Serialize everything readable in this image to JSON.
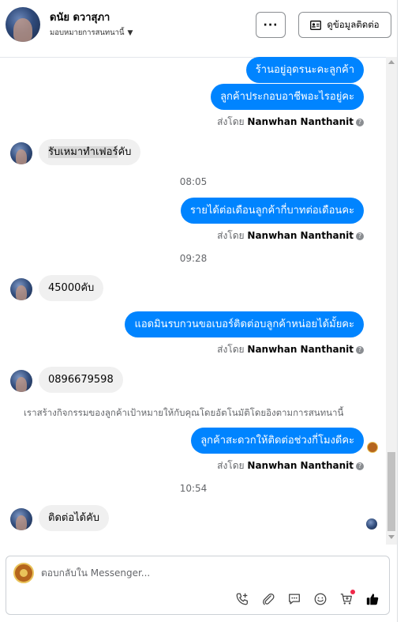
{
  "header": {
    "name": "ดนัย ดวาสุภา",
    "subtitle": "มอบหมายการสนทนานี้",
    "more_label": "···",
    "contact_label": "ดูข้อมูลติดต่อ"
  },
  "messages": {
    "out1": "ร้านอยู่อุดรนะคะลูกค้า",
    "out2": "ลูกค้าประกอบอาชีพอะไรอยู่คะ",
    "sent_prefix": "ส่งโดย",
    "sender": "Nanwhan Nanthanit",
    "in1": "รับเหมาทำเฟอร์คับ",
    "in1_highlight": "รับเหมาทำเฟอร์",
    "in1_rest": "คับ",
    "time1": "08:05",
    "out3": "รายได้ต่อเดือนลูกค้ากี่บาทต่อเดือนคะ",
    "time2": "09:28",
    "in2": "45000คับ",
    "out4": "แอดมินรบกวนขอเบอร์ติดต่อบลูกค้าหน่อยได้มั้ยคะ",
    "in3": "0896679598",
    "system_note": "เราสร้างกิจกรรมของลูกค้าเป้าหมายให้กับคุณโดยอัตโนมัติโดยอิงตามการสนทนานี้",
    "out5": "ลูกค้าสะดวกให้ติดต่อช่วงกี่โมงดีคะ",
    "time3": "10:54",
    "in4": "ติดต่อได้คับ"
  },
  "composer": {
    "placeholder": "ตอบกลับใน Messenger..."
  },
  "icons": [
    "phone-add-icon",
    "attachment-icon",
    "saved-replies-icon",
    "emoji-icon",
    "cart-icon",
    "thumbs-up-icon"
  ],
  "colors": {
    "outgoing_bubble": "#0084ff",
    "incoming_bubble": "#f0f0f0",
    "like_icon": "#050505",
    "notification_dot": "#f02849"
  }
}
